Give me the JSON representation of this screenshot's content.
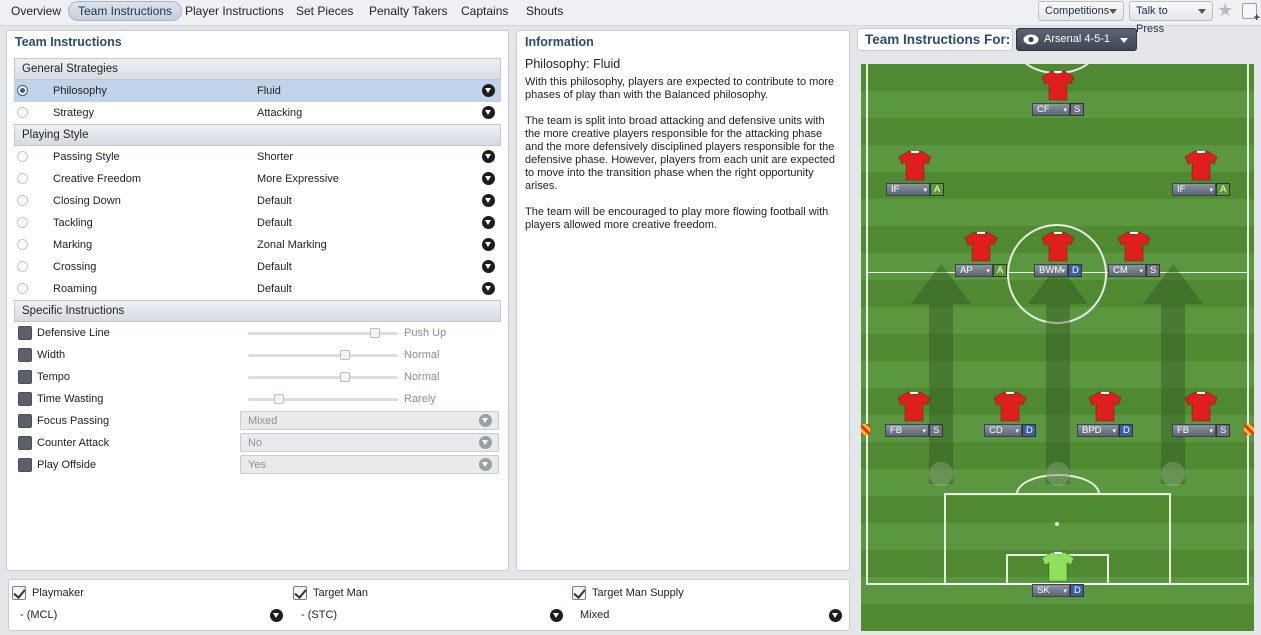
{
  "tabs": [
    "Overview",
    "Team Instructions",
    "Player Instructions",
    "Set Pieces",
    "Penalty Takers",
    "Captains",
    "Shouts"
  ],
  "active_tab": "Team Instructions",
  "top_buttons": {
    "competitions": "Competitions",
    "talk_to_press": "Talk to Press"
  },
  "left_panel": {
    "title": "Team Instructions",
    "general": {
      "header": "General Strategies",
      "rows": [
        {
          "label": "Philosophy",
          "value": "Fluid",
          "selected": true
        },
        {
          "label": "Strategy",
          "value": "Attacking",
          "selected": false
        }
      ]
    },
    "playing": {
      "header": "Playing Style",
      "rows": [
        {
          "label": "Passing Style",
          "value": "Shorter"
        },
        {
          "label": "Creative Freedom",
          "value": "More Expressive"
        },
        {
          "label": "Closing Down",
          "value": "Default"
        },
        {
          "label": "Tackling",
          "value": "Default"
        },
        {
          "label": "Marking",
          "value": "Zonal Marking"
        },
        {
          "label": "Crossing",
          "value": "Default"
        },
        {
          "label": "Roaming",
          "value": "Default"
        }
      ]
    },
    "specific": {
      "header": "Specific Instructions",
      "sliders": [
        {
          "label": "Defensive Line",
          "value": "Push Up",
          "level": 0.85
        },
        {
          "label": "Width",
          "value": "Normal",
          "level": 0.65
        },
        {
          "label": "Tempo",
          "value": "Normal",
          "level": 0.65
        },
        {
          "label": "Time Wasting",
          "value": "Rarely",
          "level": 0.2
        }
      ],
      "dropdowns": [
        {
          "label": "Focus Passing",
          "value": "Mixed"
        },
        {
          "label": "Counter Attack",
          "value": "No"
        },
        {
          "label": "Play Offside",
          "value": "Yes"
        }
      ]
    }
  },
  "info": {
    "title": "Information",
    "subtitle": "Philosophy: Fluid",
    "paragraphs": [
      "With this philosophy, players are expected to contribute to more phases of play than with the Balanced philosophy.",
      "The team is split into broad attacking and defensive units with the more creative players responsible for the attacking phase and the more defensively disciplined players responsible for the defensive phase. However, players from each unit are expected to move into the transition phase when the right opportunity arises.",
      "The team will be encouraged to play more flowing football with players allowed more creative freedom."
    ]
  },
  "bottom": [
    {
      "label": "Playmaker",
      "value": "- (MCL)"
    },
    {
      "label": "Target Man",
      "value": "- (STC)"
    },
    {
      "label": "Target Man Supply",
      "value": "Mixed"
    }
  ],
  "tactic": {
    "title": "Team Instructions For:",
    "name": "Arsenal 4-5-1"
  },
  "players": [
    {
      "pos": "CF",
      "duty": "S",
      "duty_color": "#6b7380"
    },
    {
      "pos": "IF",
      "duty": "A",
      "duty_color": "#5c9a36"
    },
    {
      "pos": "IF",
      "duty": "A",
      "duty_color": "#5c9a36"
    },
    {
      "pos": "AP",
      "duty": "A",
      "duty_color": "#5c9a36"
    },
    {
      "pos": "BWM",
      "duty": "D",
      "duty_color": "#3a5fa8"
    },
    {
      "pos": "CM",
      "duty": "S",
      "duty_color": "#6b7380"
    },
    {
      "pos": "FB",
      "duty": "S",
      "duty_color": "#6b7380"
    },
    {
      "pos": "CD",
      "duty": "D",
      "duty_color": "#3a5fa8"
    },
    {
      "pos": "BPD",
      "duty": "D",
      "duty_color": "#3a5fa8"
    },
    {
      "pos": "FB",
      "duty": "S",
      "duty_color": "#6b7380"
    },
    {
      "pos": "SK",
      "duty": "D",
      "duty_color": "#3a5fa8"
    }
  ]
}
